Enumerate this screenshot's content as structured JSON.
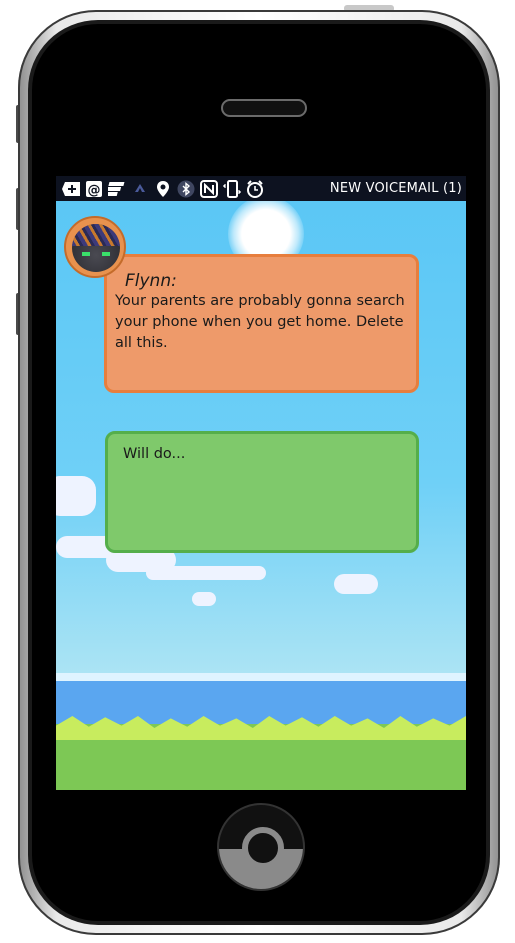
{
  "status_bar": {
    "icons": [
      "first-aid-icon",
      "at-sign-icon",
      "menu-icon",
      "signal-icon",
      "location-pin-icon",
      "bluetooth-icon",
      "nfc-icon",
      "phone-vibrate-icon",
      "alarm-icon"
    ],
    "notification": "NEW VOICEMAIL (1)"
  },
  "conversation": {
    "incoming": {
      "sender": "Flynn:",
      "text": "Your parents are probably gonna search your phone when you get home. Delete all this."
    },
    "reply": {
      "text": "Will do..."
    }
  },
  "colors": {
    "incoming_bubble": "#ee9a6a",
    "reply_bubble": "#7fc96b",
    "sky": "#59c6f5",
    "status_bar": "#0d1220"
  }
}
